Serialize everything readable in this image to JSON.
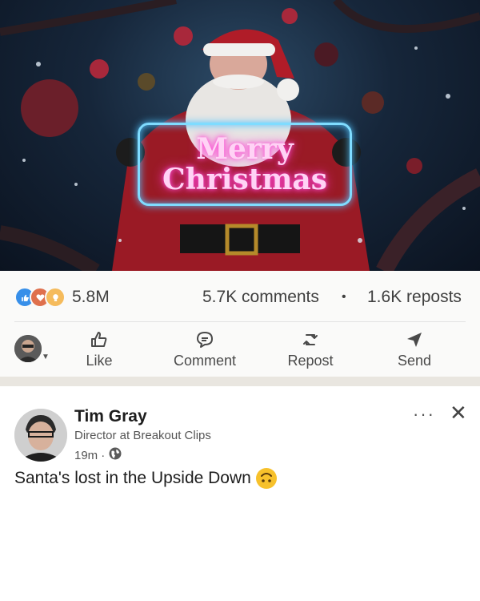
{
  "hero": {
    "sign_line1": "Merry",
    "sign_line2": "Christmas"
  },
  "stats": {
    "reaction_count": "5.8M",
    "comments": "5.7K comments",
    "dot": "•",
    "reposts": "1.6K reposts",
    "reaction_icons": [
      "like-icon",
      "love-icon",
      "insight-icon"
    ]
  },
  "actions": {
    "like": "Like",
    "comment": "Comment",
    "repost": "Repost",
    "send": "Send"
  },
  "post": {
    "author": "Tim Gray",
    "headline": "Director at Breakout Clips",
    "time": "19m",
    "dot": "·",
    "more": "···",
    "close": "✕",
    "caption": "Santa's lost in the Upside Down"
  },
  "colors": {
    "accent": "#0a66c2",
    "like": "#378fe9",
    "love": "#df704d",
    "insight": "#f5bb5c"
  }
}
